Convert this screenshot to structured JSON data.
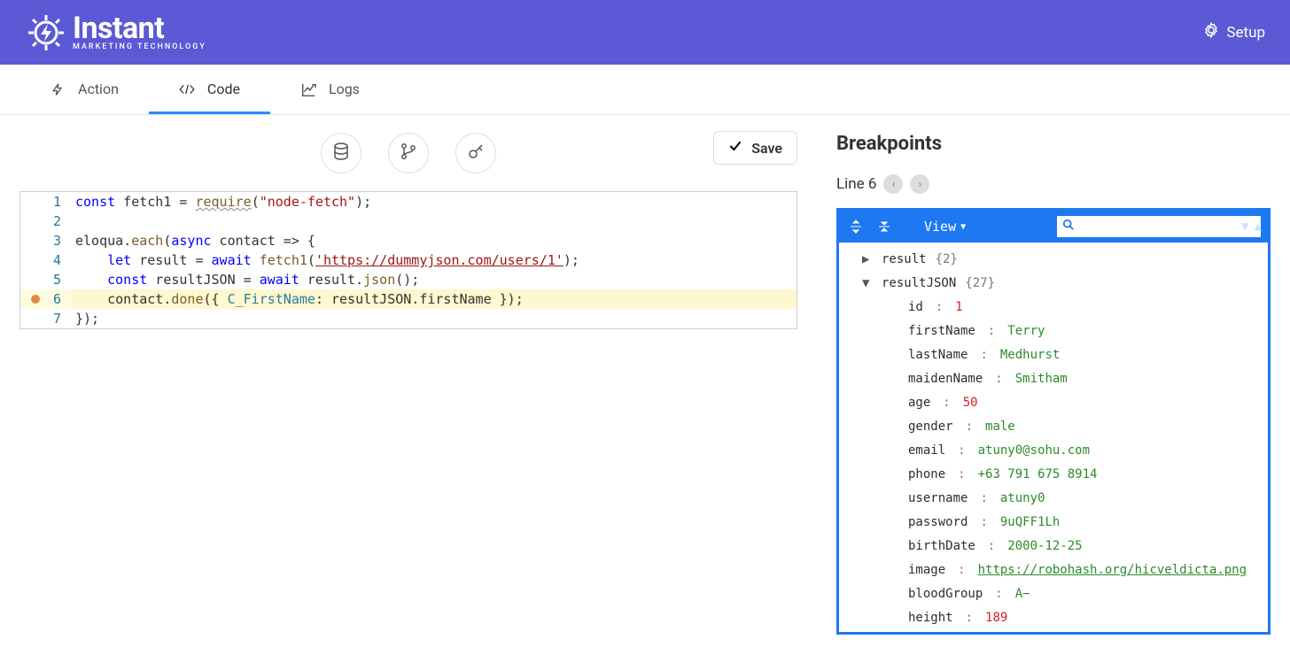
{
  "header": {
    "brand_main": "Instant",
    "brand_sub": "MARKETING TECHNOLOGY",
    "setup_label": "Setup"
  },
  "tabs": {
    "action": "Action",
    "code": "Code",
    "logs": "Logs"
  },
  "toolbar": {
    "save_label": "Save"
  },
  "editor": {
    "lines": [
      {
        "n": 1,
        "segments": [
          {
            "t": "const",
            "c": "kw"
          },
          {
            "t": " fetch1 = "
          },
          {
            "t": "require",
            "c": "fn und"
          },
          {
            "t": "("
          },
          {
            "t": "\"node-fetch\"",
            "c": "str"
          },
          {
            "t": ");"
          }
        ]
      },
      {
        "n": 2,
        "segments": []
      },
      {
        "n": 3,
        "segments": [
          {
            "t": "eloqua."
          },
          {
            "t": "each",
            "c": "fn"
          },
          {
            "t": "("
          },
          {
            "t": "async",
            "c": "kw"
          },
          {
            "t": " contact => {"
          }
        ]
      },
      {
        "n": 4,
        "segments": [
          {
            "t": "    "
          },
          {
            "t": "let",
            "c": "kw"
          },
          {
            "t": " result = "
          },
          {
            "t": "await",
            "c": "kw"
          },
          {
            "t": " "
          },
          {
            "t": "fetch1",
            "c": "fn"
          },
          {
            "t": "("
          },
          {
            "t": "'https://dummyjson.com/users/1'",
            "c": "str-u"
          },
          {
            "t": ");"
          }
        ]
      },
      {
        "n": 5,
        "segments": [
          {
            "t": "    "
          },
          {
            "t": "const",
            "c": "kw"
          },
          {
            "t": " resultJSON = "
          },
          {
            "t": "await",
            "c": "kw"
          },
          {
            "t": " result."
          },
          {
            "t": "json",
            "c": "fn"
          },
          {
            "t": "();"
          }
        ]
      },
      {
        "n": 6,
        "bp": true,
        "hl": true,
        "segments": [
          {
            "t": "    contact."
          },
          {
            "t": "done",
            "c": "fn"
          },
          {
            "t": "({ "
          },
          {
            "t": "C_FirstName",
            "c": "prop"
          },
          {
            "t": ": resultJSON.firstName });"
          }
        ]
      },
      {
        "n": 7,
        "segments": [
          {
            "t": "});"
          }
        ]
      }
    ]
  },
  "breakpoints": {
    "title": "Breakpoints",
    "line_label": "Line 6",
    "view_label": "View"
  },
  "vars": {
    "result": {
      "count": 2
    },
    "resultJSON": {
      "count": 27,
      "props": [
        {
          "k": "id",
          "v": "1",
          "type": "num"
        },
        {
          "k": "firstName",
          "v": "Terry",
          "type": "str"
        },
        {
          "k": "lastName",
          "v": "Medhurst",
          "type": "str"
        },
        {
          "k": "maidenName",
          "v": "Smitham",
          "type": "str"
        },
        {
          "k": "age",
          "v": "50",
          "type": "num"
        },
        {
          "k": "gender",
          "v": "male",
          "type": "str"
        },
        {
          "k": "email",
          "v": "atuny0@sohu.com",
          "type": "str"
        },
        {
          "k": "phone",
          "v": "+63 791 675 8914",
          "type": "str"
        },
        {
          "k": "username",
          "v": "atuny0",
          "type": "str"
        },
        {
          "k": "password",
          "v": "9uQFF1Lh",
          "type": "str"
        },
        {
          "k": "birthDate",
          "v": "2000-12-25",
          "type": "str"
        },
        {
          "k": "image",
          "v": "https://robohash.org/hicveldicta.png",
          "type": "url"
        },
        {
          "k": "bloodGroup",
          "v": "A−",
          "type": "str"
        },
        {
          "k": "height",
          "v": "189",
          "type": "num"
        }
      ]
    }
  }
}
